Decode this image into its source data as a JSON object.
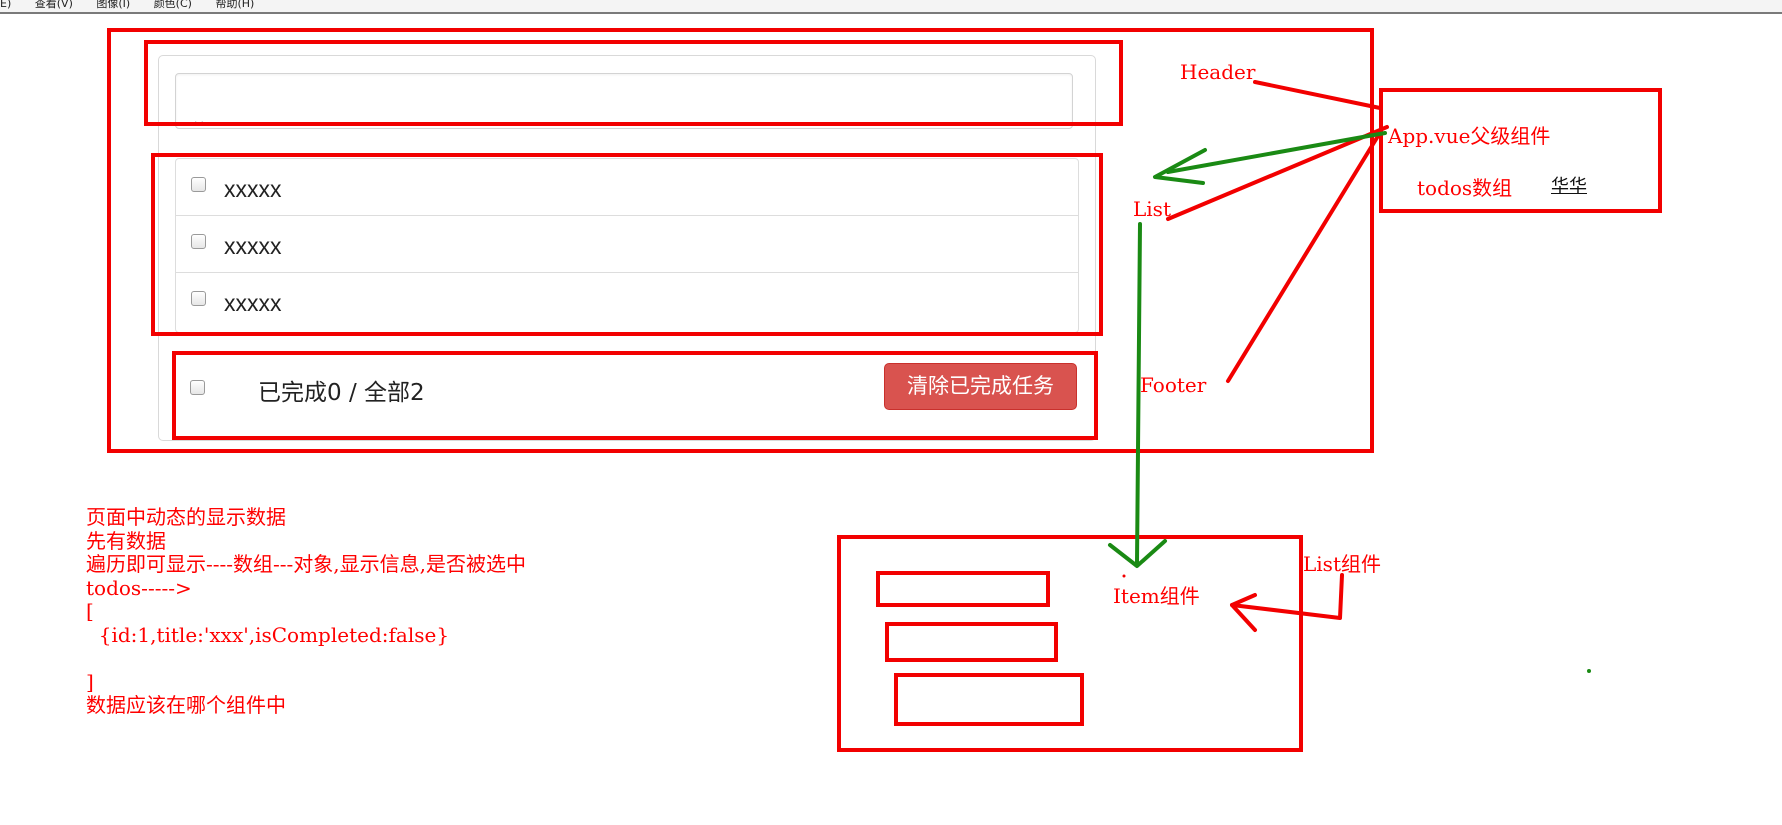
{
  "menubar": {
    "items": [
      "E)",
      "查看(V)",
      "图像(I)",
      "颜色(C)",
      "帮助(H)"
    ]
  },
  "header": {
    "input_value": ". ."
  },
  "list": {
    "items": [
      {
        "title": "xxxxx",
        "completed": false
      },
      {
        "title": "xxxxx",
        "completed": false
      },
      {
        "title": "xxxxx",
        "completed": false
      }
    ]
  },
  "footer": {
    "status_text": "已完成0 / 全部2",
    "clear_button_label": "清除已完成任务"
  },
  "annotations": {
    "header_label": "Header",
    "list_label": "List",
    "footer_label": "Footer",
    "app_label": "App.vue父级组件",
    "todos_label": "todos数组",
    "huahua_label": "华华",
    "item_label": "Item组件",
    "list_component_label": "List组件"
  },
  "notes": [
    "页面中动态的显示数据",
    "先有数据",
    "遍历即可显示----数组---对象,显示信息,是否被选中",
    "todos----->",
    "[",
    "  {id:1,title:'xxx',isCompleted:false}",
    "",
    "]",
    "数据应该在哪个组件中"
  ],
  "colors": {
    "annotation_red": "#f20000",
    "arrow_green": "#1a8a14",
    "button_red": "#d9534f"
  }
}
